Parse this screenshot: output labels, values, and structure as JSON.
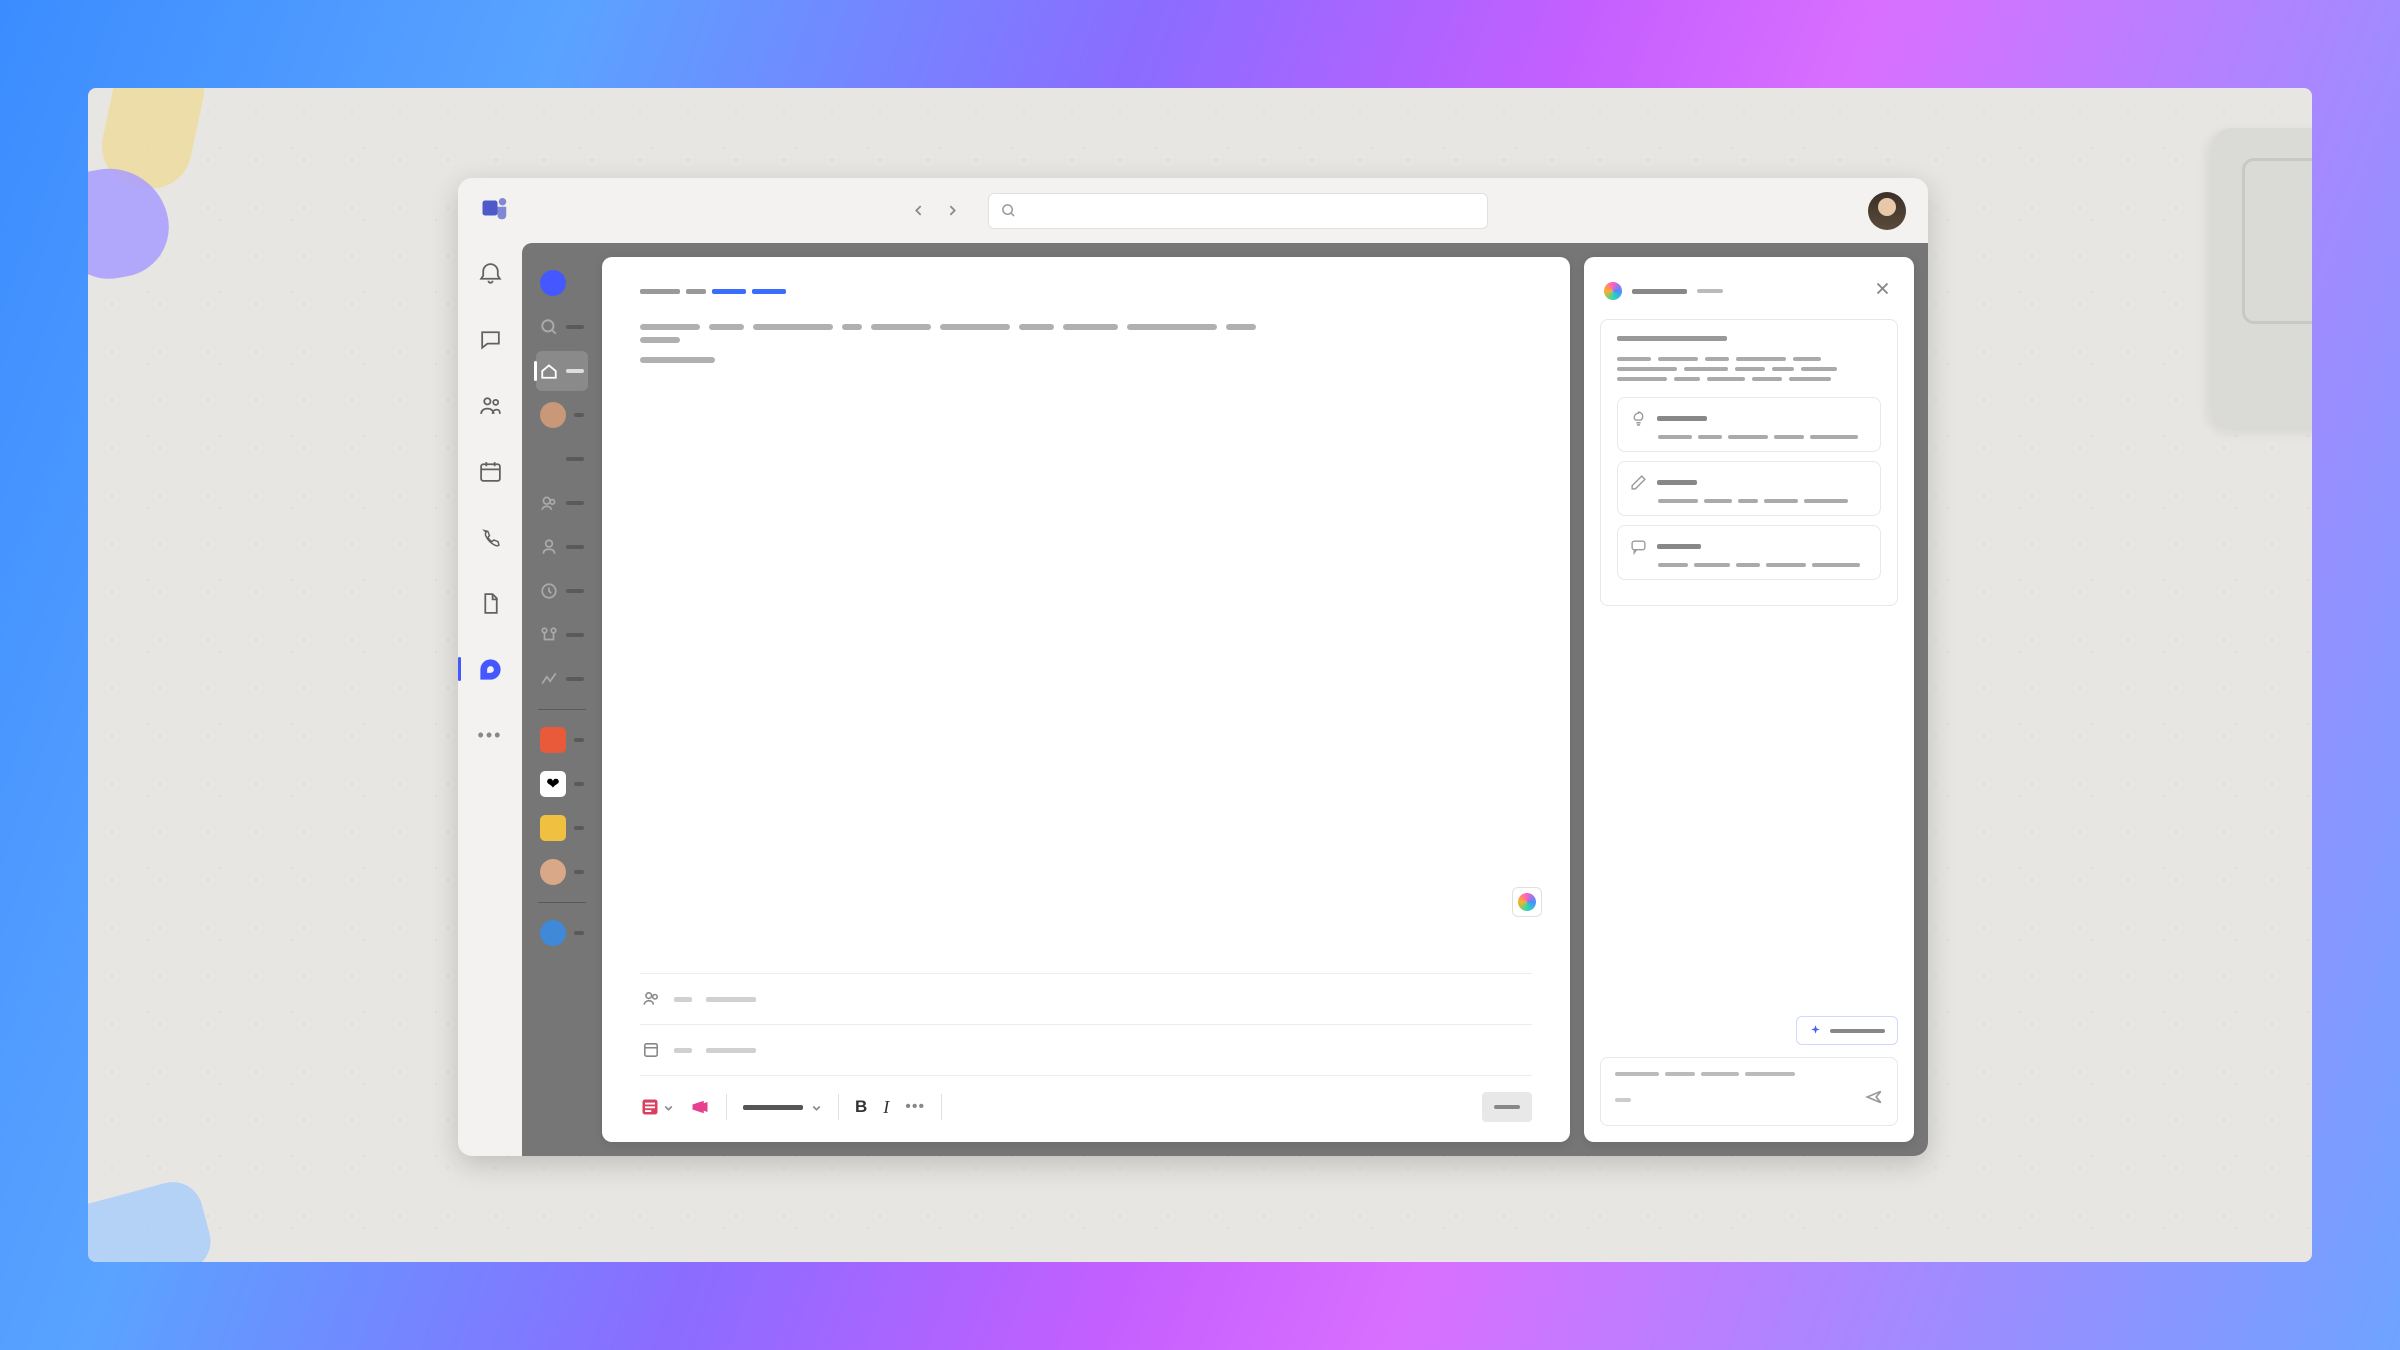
{
  "nav": {
    "items": [
      "activity",
      "chat",
      "teams",
      "calendar",
      "calls",
      "files",
      "loop",
      "more"
    ],
    "active": "loop"
  },
  "breadcrumb": {
    "seg1_link": true,
    "seg2_link": true
  },
  "meta": {
    "row1": "people",
    "row2": "template"
  },
  "toolbar": {
    "bold": "B",
    "italic": "I"
  },
  "copilot": {
    "title": "Copilot",
    "suggestions": [
      {
        "icon": "lightbulb"
      },
      {
        "icon": "pencil"
      },
      {
        "icon": "chat"
      }
    ],
    "chip_icon": "sparkle"
  },
  "apps": {
    "top": [
      {
        "type": "logo",
        "color": "#4558ff"
      },
      {
        "type": "search"
      },
      {
        "type": "home",
        "selected": true
      },
      {
        "type": "avatar"
      },
      {
        "type": "blank"
      },
      {
        "type": "glyph"
      },
      {
        "type": "glyph"
      },
      {
        "type": "glyph"
      },
      {
        "type": "glyph"
      },
      {
        "type": "glyph"
      }
    ],
    "bottom": [
      {
        "color": "#e85a3a"
      },
      {
        "color": "#d91a4a"
      },
      {
        "color": "#f0c040"
      },
      {
        "color": "#d8a888"
      },
      {
        "type": "blank"
      },
      {
        "color": "#4088d8",
        "round": true
      }
    ]
  }
}
